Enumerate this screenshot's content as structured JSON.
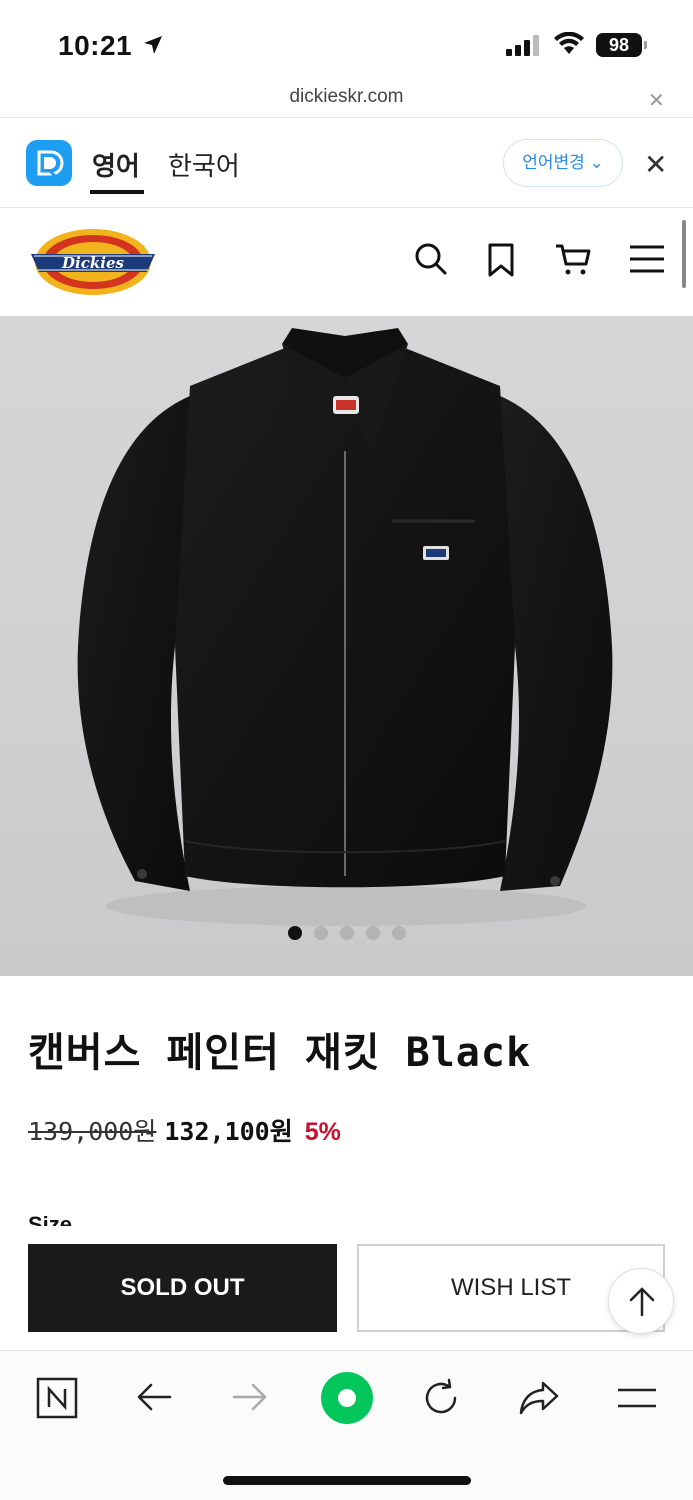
{
  "status_bar": {
    "time": "10:21",
    "battery": "98"
  },
  "browser": {
    "url": "dickieskr.com"
  },
  "translate_bar": {
    "tab_english": "영어",
    "tab_korean": "한국어",
    "change_language": "언어변경"
  },
  "site": {
    "brand": "Dickies"
  },
  "carousel": {
    "total": 5,
    "active": 0
  },
  "product": {
    "title": "캔버스 페인터 재킷 Black",
    "original_price": "139,000원",
    "sale_price": "132,100원",
    "discount": "5%",
    "next_section_peek": "Size"
  },
  "actions": {
    "sold_out": "SOLD OUT",
    "wish_list": "WISH LIST"
  },
  "colors": {
    "discount": "#c8102e",
    "accent_green": "#03c75a",
    "translate_blue": "#1e9ef3"
  },
  "icons": [
    "location-arrow-icon",
    "signal-icon",
    "wifi-icon",
    "search-icon",
    "bookmark-icon",
    "cart-icon",
    "menu-icon",
    "scroll-top-icon",
    "naver-icon",
    "back-icon",
    "forward-icon",
    "green-dot-icon",
    "reload-icon",
    "share-icon",
    "hamburger-icon"
  ]
}
